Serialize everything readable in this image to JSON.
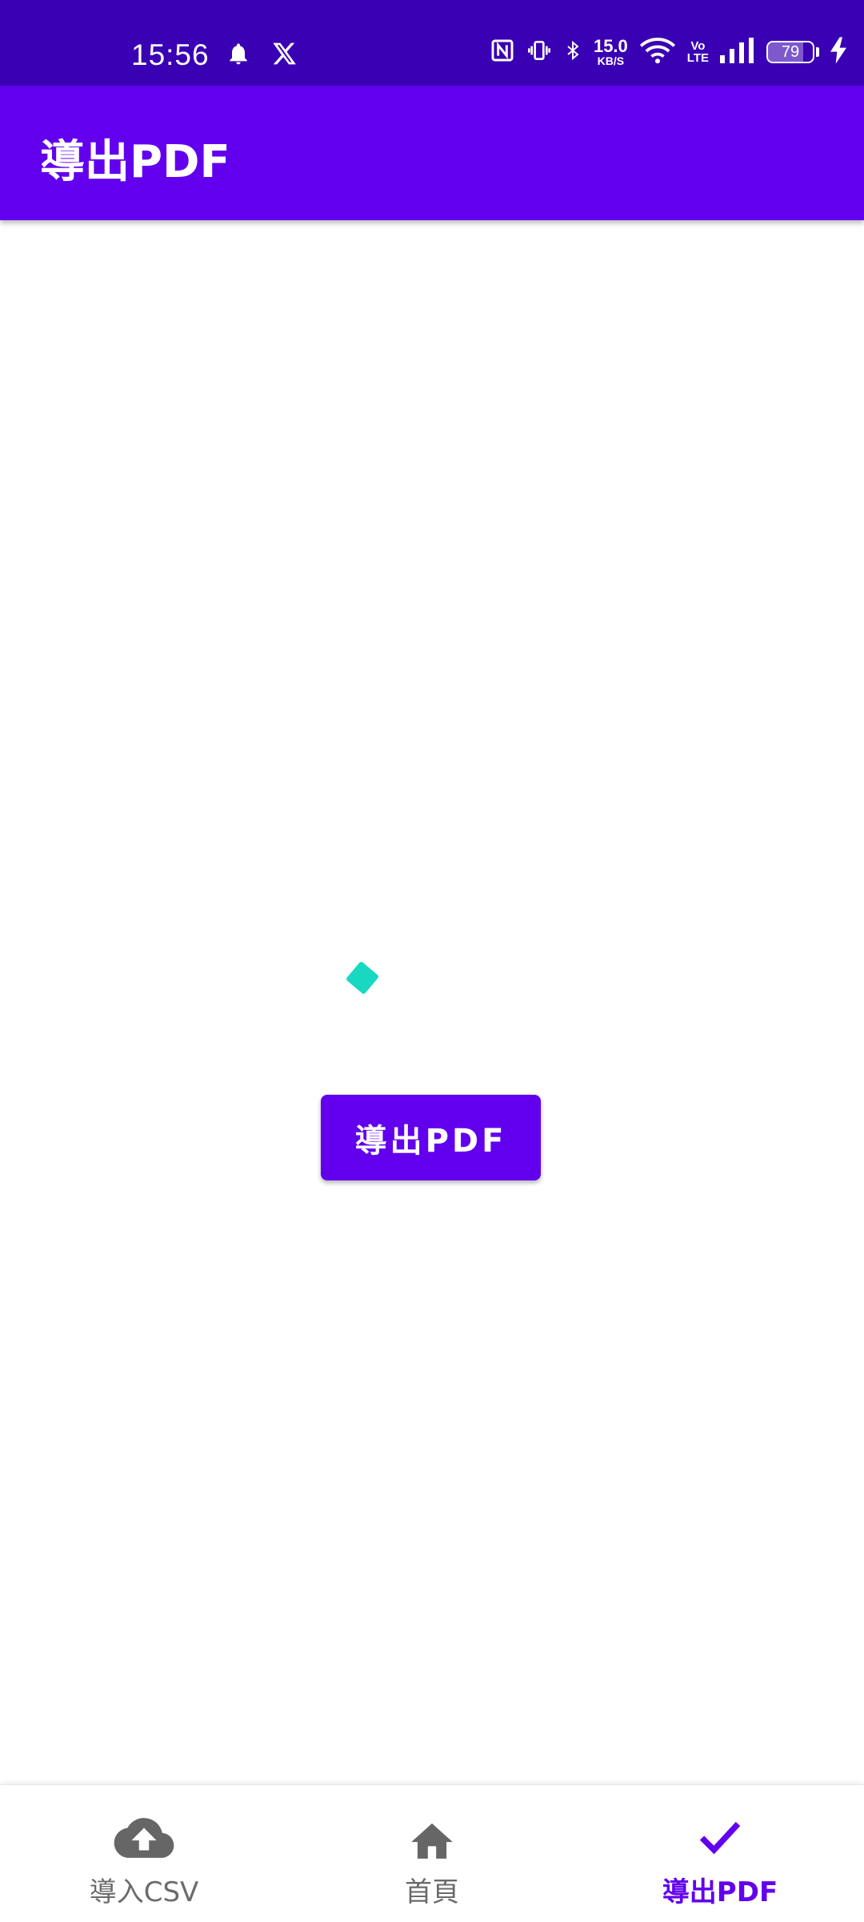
{
  "status_bar": {
    "time": "15:56",
    "network_speed_value": "15.0",
    "network_speed_unit": "KB/S",
    "volte_top": "Vo",
    "volte_bottom": "LTE",
    "battery_level": "79",
    "battery_fraction": 0.79,
    "icons": [
      "bell-icon",
      "x-logo-icon",
      "nfc-icon",
      "vibrate-icon",
      "bluetooth-icon",
      "wifi-icon",
      "signal-icon",
      "charging-bolt-icon"
    ],
    "background_color": "#3a00b3"
  },
  "app_bar": {
    "title": "導出PDF",
    "background_color": "#6200ee"
  },
  "main": {
    "export_button_label": "導出PDF",
    "spinner_color": "#18d8c2"
  },
  "bottom_nav": {
    "items": [
      {
        "label": "導入CSV",
        "icon": "cloud-upload-icon",
        "active": false
      },
      {
        "label": "首頁",
        "icon": "home-icon",
        "active": false
      },
      {
        "label": "導出PDF",
        "icon": "check-icon",
        "active": true
      }
    ],
    "active_color": "#6200ee",
    "inactive_color": "#6b6b6b"
  }
}
